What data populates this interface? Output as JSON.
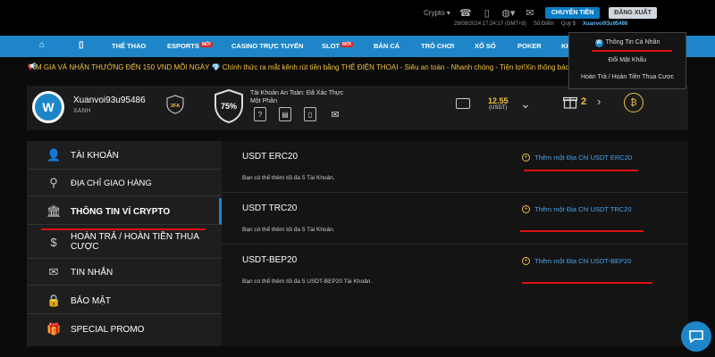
{
  "topbar": {
    "currency": "Crypto",
    "transfer_label": "CHUYỂN TIỀN",
    "logout_label": "ĐĂNG XUẤT",
    "datetime": "28/09/2024 17:24:17 (GMT+8)",
    "points_label": "Số Điểm",
    "fund_label": "Quỹ $",
    "username": "Xuanvoi93u95486"
  },
  "nav": {
    "items": [
      "THỂ THAO",
      "ESPORTS",
      "CASINO TRỰC TUYẾN",
      "SLOT",
      "BẮN CÁ",
      "TRÒ CHƠI",
      "XỔ SỐ",
      "POKER",
      "KH"
    ],
    "new_badge": "MỚI"
  },
  "marquee": {
    "text": "M GIA VÀ NHẬN THƯỞNG ĐẾN 150 VND MỖI NGÀY 💎 Chính thức ra mắt kênh rút tiền bằng THẺ ĐIỆN THOẠI - Siêu an toàn - Nhanh chóng - Tiện lợi!Xin thông báo, hiện"
  },
  "dropdown": {
    "items": [
      "Thông Tin Cá Nhân",
      "Đổi Mật Khẩu",
      "Hoàn Trả / Hoàn Tiền Thua Cược"
    ]
  },
  "account": {
    "logo_letter": "W",
    "username": "Xuanvoi93u95486",
    "level": "XANH",
    "badge_2fa": "2FA",
    "security_percent": "75%",
    "security_text_line1": "Tài Khoản An Toàn: Đã Xác Thực",
    "security_text_line2": "Một Phần",
    "balance": "12.55",
    "balance_unit": "(USDT)",
    "gift_count": "2"
  },
  "sidebar": {
    "items": [
      {
        "label": "TÀI KHOẢN",
        "icon": "user-icon"
      },
      {
        "label": "ĐỊA CHỈ GIAO HÀNG",
        "icon": "location-icon"
      },
      {
        "label": "THÔNG TIN VÍ CRYPTO",
        "icon": "bank-icon"
      },
      {
        "label": "HOÀN TRẢ / HOÀN TIỀN THUA CƯỢC",
        "icon": "refund-icon"
      },
      {
        "label": "TIN NHẮN",
        "icon": "mail-icon"
      },
      {
        "label": "BẢO MẬT",
        "icon": "lock-icon"
      },
      {
        "label": "SPECIAL PROMO",
        "icon": "gift-icon"
      }
    ]
  },
  "crypto": {
    "rows": [
      {
        "name": "USDT ERC20",
        "note": "Bạn có thể thêm tối đa 5 Tài Khoản.",
        "add": "Thêm một Địa Chỉ USDT ERC20"
      },
      {
        "name": "USDT TRC20",
        "note": "Bạn có thể thêm tối đa 5 Tài Khoản.",
        "add": "Thêm một Địa Chỉ USDT TRC20"
      },
      {
        "name": "USDT-BEP20",
        "note": "Bạn có thể thêm tối đa 5 USDT-BEP20 Tài Khoản.",
        "add": "Thêm một Địa Chỉ USDT-BEP20"
      }
    ]
  },
  "colors": {
    "accent": "#1e86c8",
    "gold": "#f0c040",
    "highlight": "#e01010"
  }
}
